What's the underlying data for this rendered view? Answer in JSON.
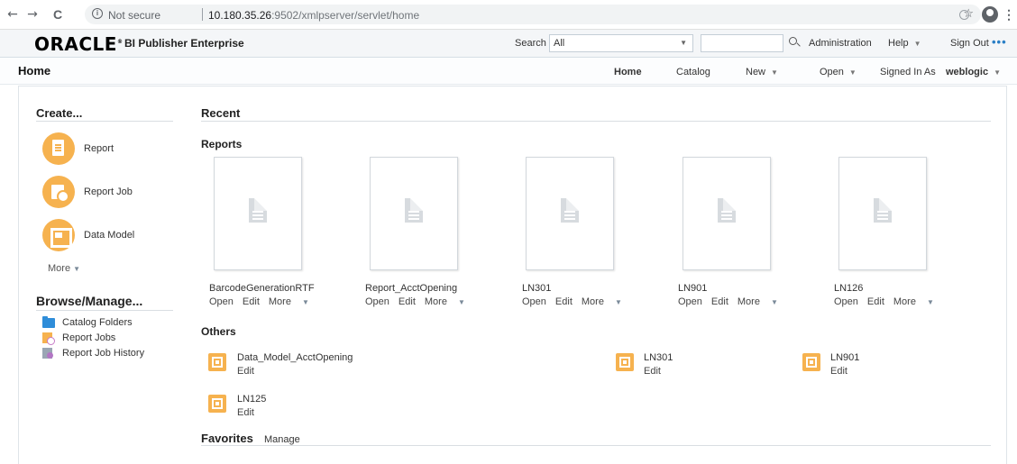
{
  "browser": {
    "not_secure": "Not secure",
    "url_host": "10.180.35.26",
    "url_rest": ":9502/xmlpserver/servlet/home",
    "back": "←",
    "forward": "→",
    "reload": "C",
    "star": "☆"
  },
  "header": {
    "logo": "ORACLE",
    "logo_mark": "®",
    "product": "BI Publisher Enterprise",
    "search_label": "Search",
    "search_scope": "All",
    "administration": "Administration",
    "help": "Help",
    "sign_out": "Sign Out",
    "more": "•••"
  },
  "pagebar": {
    "title": "Home",
    "home": "Home",
    "catalog": "Catalog",
    "new": "New",
    "open": "Open",
    "signed_in_as": "Signed In As",
    "user": "weblogic"
  },
  "create": {
    "title": "Create...",
    "items": [
      "Report",
      "Report Job",
      "Data Model"
    ],
    "more": "More"
  },
  "browse": {
    "title": "Browse/Manage...",
    "items": [
      "Catalog Folders",
      "Report Jobs",
      "Report Job History"
    ]
  },
  "recent": {
    "title": "Recent",
    "reports_title": "Reports",
    "reports": [
      {
        "name": "BarcodeGenerationRTF",
        "open": "Open",
        "edit": "Edit",
        "more": "More"
      },
      {
        "name": "Report_AcctOpening",
        "open": "Open",
        "edit": "Edit",
        "more": "More"
      },
      {
        "name": "LN301",
        "open": "Open",
        "edit": "Edit",
        "more": "More"
      },
      {
        "name": "LN901",
        "open": "Open",
        "edit": "Edit",
        "more": "More"
      },
      {
        "name": "LN126",
        "open": "Open",
        "edit": "Edit",
        "more": "More"
      }
    ],
    "others_title": "Others",
    "others": [
      {
        "name": "Data_Model_AcctOpening",
        "edit": "Edit"
      },
      {
        "name": "LN301",
        "edit": "Edit"
      },
      {
        "name": "LN901",
        "edit": "Edit"
      },
      {
        "name": "LN125",
        "edit": "Edit"
      }
    ]
  },
  "favorites": {
    "title": "Favorites",
    "manage": "Manage"
  },
  "colors": {
    "accent_orange": "#f6b24f",
    "folder_blue": "#2f8dd9",
    "link_blue": "#2a7fc6"
  }
}
